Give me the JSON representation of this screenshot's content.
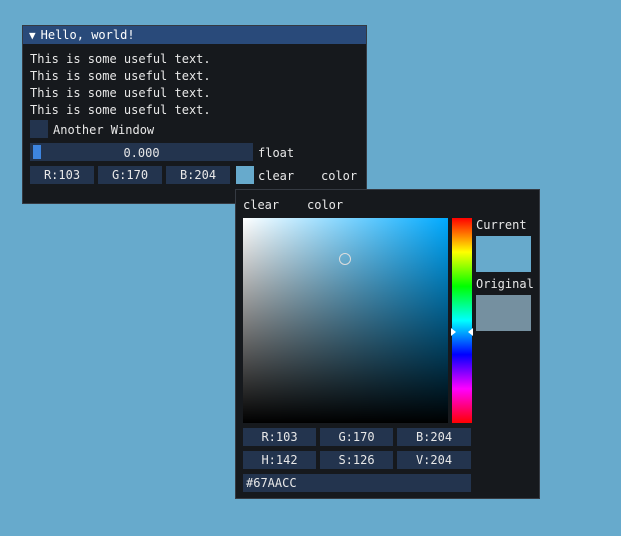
{
  "hello_window": {
    "title": "Hello, world!",
    "lines": [
      "This is some useful text.",
      "This is some useful text.",
      "This is some useful text.",
      "This is some useful text."
    ],
    "checkbox_label": "Another Window",
    "slider": {
      "value_text": "0.000",
      "label": "float",
      "fraction": 0.0
    },
    "color_fields": {
      "r": "R:103",
      "g": "G:170",
      "b": "B:204"
    },
    "clear_label": "clear",
    "color_label": "color"
  },
  "picker": {
    "title_clear": "clear",
    "title_color": "color",
    "current_label": "Current",
    "original_label": "Original",
    "rgb": {
      "r": "R:103",
      "g": "G:170",
      "b": "B:204"
    },
    "hsv": {
      "h": "H:142",
      "s": "S:126",
      "v": "V:204"
    },
    "hex": "#67AACC"
  },
  "colors": {
    "background": "#67AACC",
    "current": "#67AACC",
    "original": "#7590A0",
    "hue_base": "#00AAFF",
    "title_bar": "#294A7A",
    "frame": "#23344E"
  },
  "icons": {
    "collapse": "triangle-down-icon"
  }
}
